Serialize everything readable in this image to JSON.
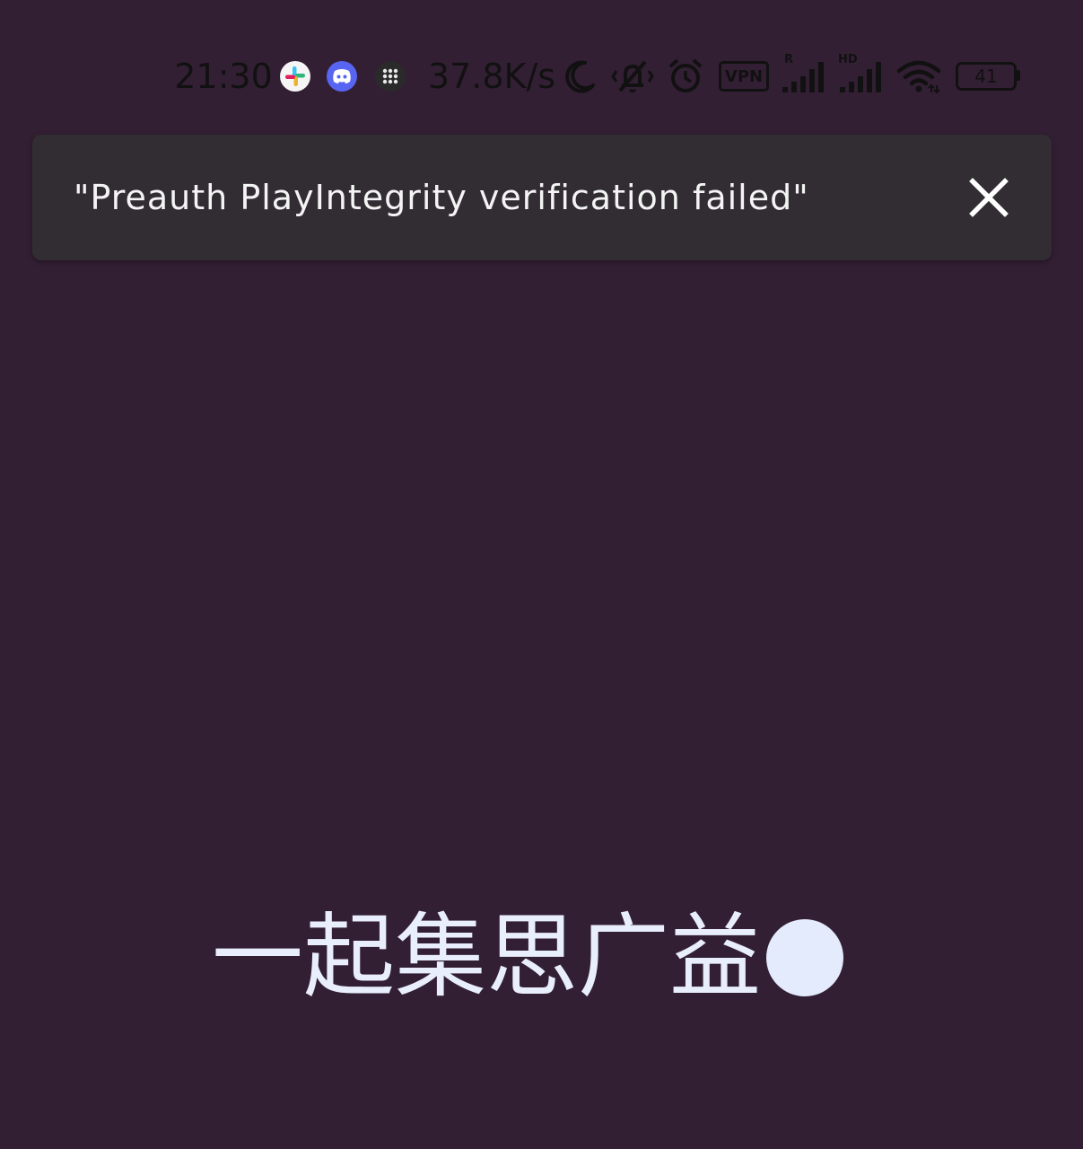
{
  "status_bar": {
    "time": "21:30",
    "network_speed": "37.8K/s",
    "battery_level": "41",
    "icons": [
      "slack-icon",
      "discord-icon",
      "app-grid-icon",
      "moon-icon",
      "vibrate-icon",
      "alarm-icon",
      "vpn-icon",
      "signal-roaming-icon",
      "signal-hd-icon",
      "wifi-icon",
      "battery-icon"
    ],
    "vpn_label": "VPN",
    "roaming_label": "R",
    "hd_label": "HD"
  },
  "toast": {
    "message": "\"Preauth PlayIntegrity verification failed\""
  },
  "content": {
    "typing_text": "一起集思广益"
  },
  "colors": {
    "background": "#331f33",
    "toast_background": "#322d33",
    "text_light": "#e8eefc",
    "status_dark": "#111111"
  }
}
